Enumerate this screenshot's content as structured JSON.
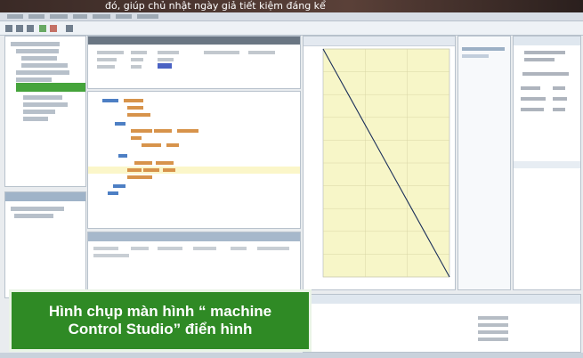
{
  "topbar": {
    "title": "đó, giúp chủ nhật ngày giả tiết kiệm đáng kể"
  },
  "caption": {
    "line1": "Hình chụp màn hình “ machine",
    "line2": "Control Studio” điển hình"
  },
  "chart_data": {
    "type": "line",
    "x": [
      0,
      1,
      2,
      3,
      4,
      5,
      6,
      7,
      8,
      9,
      10
    ],
    "series": [
      {
        "values": [
          10,
          9,
          8,
          7,
          6,
          5,
          4,
          3,
          2,
          1,
          0
        ]
      }
    ],
    "xlim": [
      0,
      10
    ],
    "ylim": [
      0,
      10
    ],
    "grid": true,
    "colors": {
      "plot_area": "#f7f6c8",
      "grid": "#d9d6a6",
      "line": "#1b2f5a"
    }
  },
  "icons": {
    "menu": "menu-icon",
    "toolbar": [
      "new-icon",
      "open-icon",
      "save-icon",
      "run-icon",
      "stop-icon"
    ],
    "tree": "tree-icon"
  }
}
